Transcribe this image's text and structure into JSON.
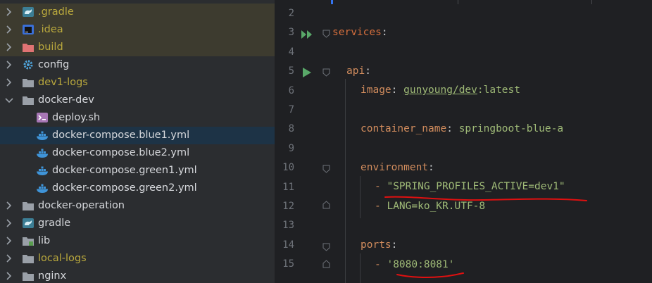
{
  "tree": {
    "items": [
      {
        "label": ".gradle",
        "color": "olive",
        "icon": "gradle-icon",
        "row": "hl-yellow",
        "expanded": false
      },
      {
        "label": ".idea",
        "color": "olive",
        "icon": "idea-folder-icon",
        "row": "hl-yellow",
        "expanded": false
      },
      {
        "label": "build",
        "color": "olive",
        "icon": "build-folder-icon",
        "row": "hl-yellow",
        "expanded": false
      },
      {
        "label": "config",
        "color": "normal",
        "icon": "config-folder-icon",
        "row": "",
        "expanded": false
      },
      {
        "label": "dev1-logs",
        "color": "olive",
        "icon": "folder-icon",
        "row": "",
        "expanded": false
      },
      {
        "label": "docker-dev",
        "color": "normal",
        "icon": "folder-icon",
        "row": "",
        "expanded": true
      },
      {
        "label": "deploy.sh",
        "color": "normal",
        "icon": "shell-script-icon",
        "row": "",
        "file": true
      },
      {
        "label": "docker-compose.blue1.yml",
        "color": "normal",
        "icon": "docker-icon",
        "row": "selected",
        "file": true
      },
      {
        "label": "docker-compose.blue2.yml",
        "color": "normal",
        "icon": "docker-icon",
        "row": "",
        "file": true
      },
      {
        "label": "docker-compose.green1.yml",
        "color": "normal",
        "icon": "docker-icon",
        "row": "",
        "file": true
      },
      {
        "label": "docker-compose.green2.yml",
        "color": "normal",
        "icon": "docker-icon",
        "row": "",
        "file": true
      },
      {
        "label": "docker-operation",
        "color": "normal",
        "icon": "folder-icon",
        "row": "",
        "expanded": false
      },
      {
        "label": "gradle",
        "color": "normal",
        "icon": "gradle-icon",
        "row": "",
        "expanded": false
      },
      {
        "label": "lib",
        "color": "normal",
        "icon": "lib-folder-icon",
        "row": "",
        "expanded": false
      },
      {
        "label": "local-logs",
        "color": "olive",
        "icon": "folder-icon",
        "row": "",
        "expanded": false
      },
      {
        "label": "nginx",
        "color": "normal",
        "icon": "folder-icon",
        "row": "",
        "expanded": false
      }
    ]
  },
  "editor": {
    "line_numbers": [
      "2",
      "3",
      "4",
      "5",
      "6",
      "7",
      "8",
      "9",
      "10",
      "11",
      "12",
      "13",
      "14",
      "15"
    ],
    "services_key": "services",
    "api_key": "api",
    "image_key": "image",
    "image_repo": "gunyoung/dev",
    "image_tag": ":latest",
    "container_name_key": "container_name",
    "container_name_value": "springboot-blue-a",
    "environment_key": "environment",
    "env_1": "\"SPRING_PROFILES_ACTIVE=dev1\"",
    "env_2": "LANG=ko_KR.UTF-8",
    "ports_key": "ports",
    "port_1": "'8080:8081'",
    "dash": "- ",
    "colon": ":"
  },
  "colors": {
    "accent_annotation": "#e01010",
    "run_gutter": "#59a869",
    "key": "#d18c5d",
    "value": "#9fba77"
  }
}
